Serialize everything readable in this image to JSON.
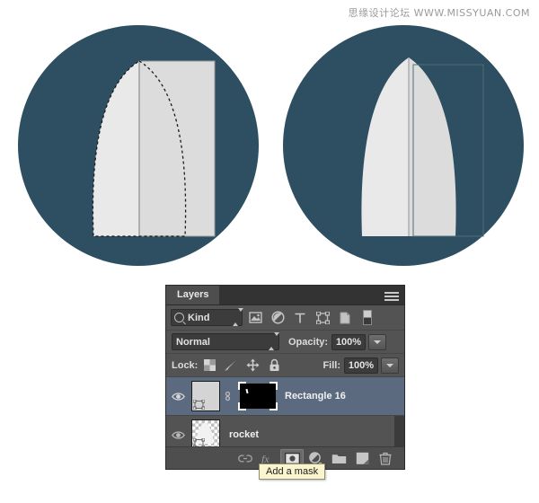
{
  "watermark": "思缘设计论坛  WWW.MISSYUAN.COM",
  "colors": {
    "circle_fill": "#2d4f61",
    "shape_light": "#e9e9e9",
    "shape_shade": "#dcdcdc",
    "shape_divider": "#b0b0b0",
    "panel_bg": "#535353",
    "selected_row": "#5c6a80",
    "tooltip_bg": "#fbf5cf",
    "canvas_bg": "#ffffff"
  },
  "illustrations": [
    {
      "name": "left-circle-with-selection",
      "caption": "Circle with half nose-cone shape, dashed marquee selection and rectangle overlay",
      "has_marching_ants": true,
      "has_rect_overlay": true
    },
    {
      "name": "right-circle-completed",
      "caption": "Circle with completed symmetric rocket nose cone and faint rectangle outline",
      "has_marching_ants": false,
      "has_rect_overlay": true
    }
  ],
  "panel": {
    "tab_label": "Layers",
    "menu_icon": "panel-menu-icon",
    "filter": {
      "search_icon": "search-icon",
      "kind_label": "Kind",
      "stepper_icon": "updown-stepper-icon",
      "icons": [
        {
          "name": "filter-pixel-icon",
          "title": "Pixel layers"
        },
        {
          "name": "filter-adjustment-icon",
          "title": "Adjustment layers"
        },
        {
          "name": "filter-type-icon",
          "title": "Type layers"
        },
        {
          "name": "filter-shape-icon",
          "title": "Shape layers"
        },
        {
          "name": "filter-smart-object-icon",
          "title": "Smart objects"
        },
        {
          "name": "filter-toggle-icon",
          "title": "Turn filtering on/off"
        }
      ]
    },
    "blend": {
      "mode": "Normal",
      "opacity_label": "Opacity:",
      "opacity_value": "100%",
      "fill_label": "Fill:",
      "fill_value": "100%"
    },
    "lock": {
      "label": "Lock:",
      "icons": [
        {
          "name": "lock-transparency-icon",
          "title": "Lock transparent pixels"
        },
        {
          "name": "lock-image-icon",
          "title": "Lock image pixels"
        },
        {
          "name": "lock-position-icon",
          "title": "Lock position"
        },
        {
          "name": "lock-all-icon",
          "title": "Lock all"
        }
      ]
    },
    "layers": [
      {
        "name": "Rectangle 16",
        "visible": true,
        "selected": true,
        "thumb_type": "shape",
        "has_link": true,
        "has_mask": true,
        "mask_selected": true
      },
      {
        "name": "rocket",
        "visible": false,
        "selected": false,
        "thumb_type": "transparent",
        "has_link": false,
        "has_mask": false,
        "mask_selected": false
      }
    ],
    "bottom_icons": [
      {
        "name": "link-layers-icon",
        "title": "Link layers",
        "active": false
      },
      {
        "name": "layer-style-fx-icon",
        "title": "Add a layer style",
        "active": false
      },
      {
        "name": "add-mask-icon",
        "title": "Add a mask",
        "active": true
      },
      {
        "name": "new-adjustment-layer-icon",
        "title": "Create new fill or adjustment layer",
        "active": false
      },
      {
        "name": "new-group-icon",
        "title": "Create a new group",
        "active": false
      },
      {
        "name": "new-layer-icon",
        "title": "Create a new layer",
        "active": false
      },
      {
        "name": "delete-layer-icon",
        "title": "Delete layer",
        "active": false
      }
    ],
    "tooltip": "Add a mask"
  }
}
